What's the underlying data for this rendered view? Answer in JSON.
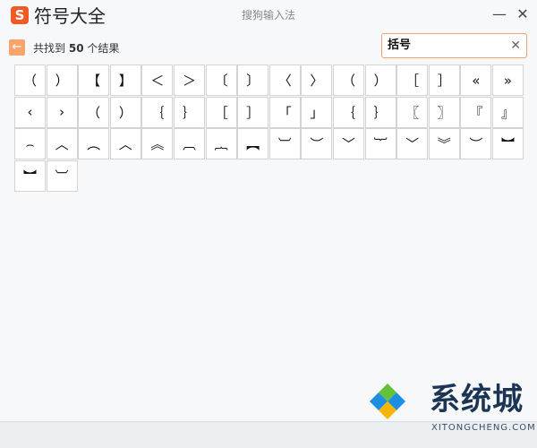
{
  "app": {
    "logo_letter": "S",
    "title": "符号大全",
    "window_title": "搜狗输入法",
    "minimize": "—",
    "close": "✕"
  },
  "results": {
    "prefix": "共找到",
    "count": "50",
    "suffix": "个结果",
    "back_glyph": "←"
  },
  "search": {
    "value": "括号",
    "clear_glyph": "✕"
  },
  "symbols": [
    "（",
    "）",
    "【",
    "】",
    "＜",
    "＞",
    "〔",
    "〕",
    "〈",
    "〉",
    "（",
    "）",
    "［",
    "］",
    "«",
    "»",
    "‹",
    "›",
    "（",
    "）",
    "｛",
    "｝",
    "［",
    "］",
    "「",
    "」",
    "｛",
    "｝",
    "〖",
    "〗",
    "『",
    "』",
    "⌢",
    "︿",
    "︵",
    "︿",
    "︽",
    "︹",
    "︷",
    "︻",
    "︺",
    "︶",
    "﹀",
    "︸",
    "﹀",
    "︾",
    "︶",
    "︼",
    "︼",
    "︺"
  ],
  "watermark": {
    "text": "系统城",
    "sub": "XITONGCHENG.COM"
  },
  "colors": {
    "accent": "#f05a24",
    "search_border": "#f3a26b",
    "cell_border": "#d3d3d3",
    "watermark_blue": "#1d8fe0",
    "watermark_green": "#63c23a"
  }
}
